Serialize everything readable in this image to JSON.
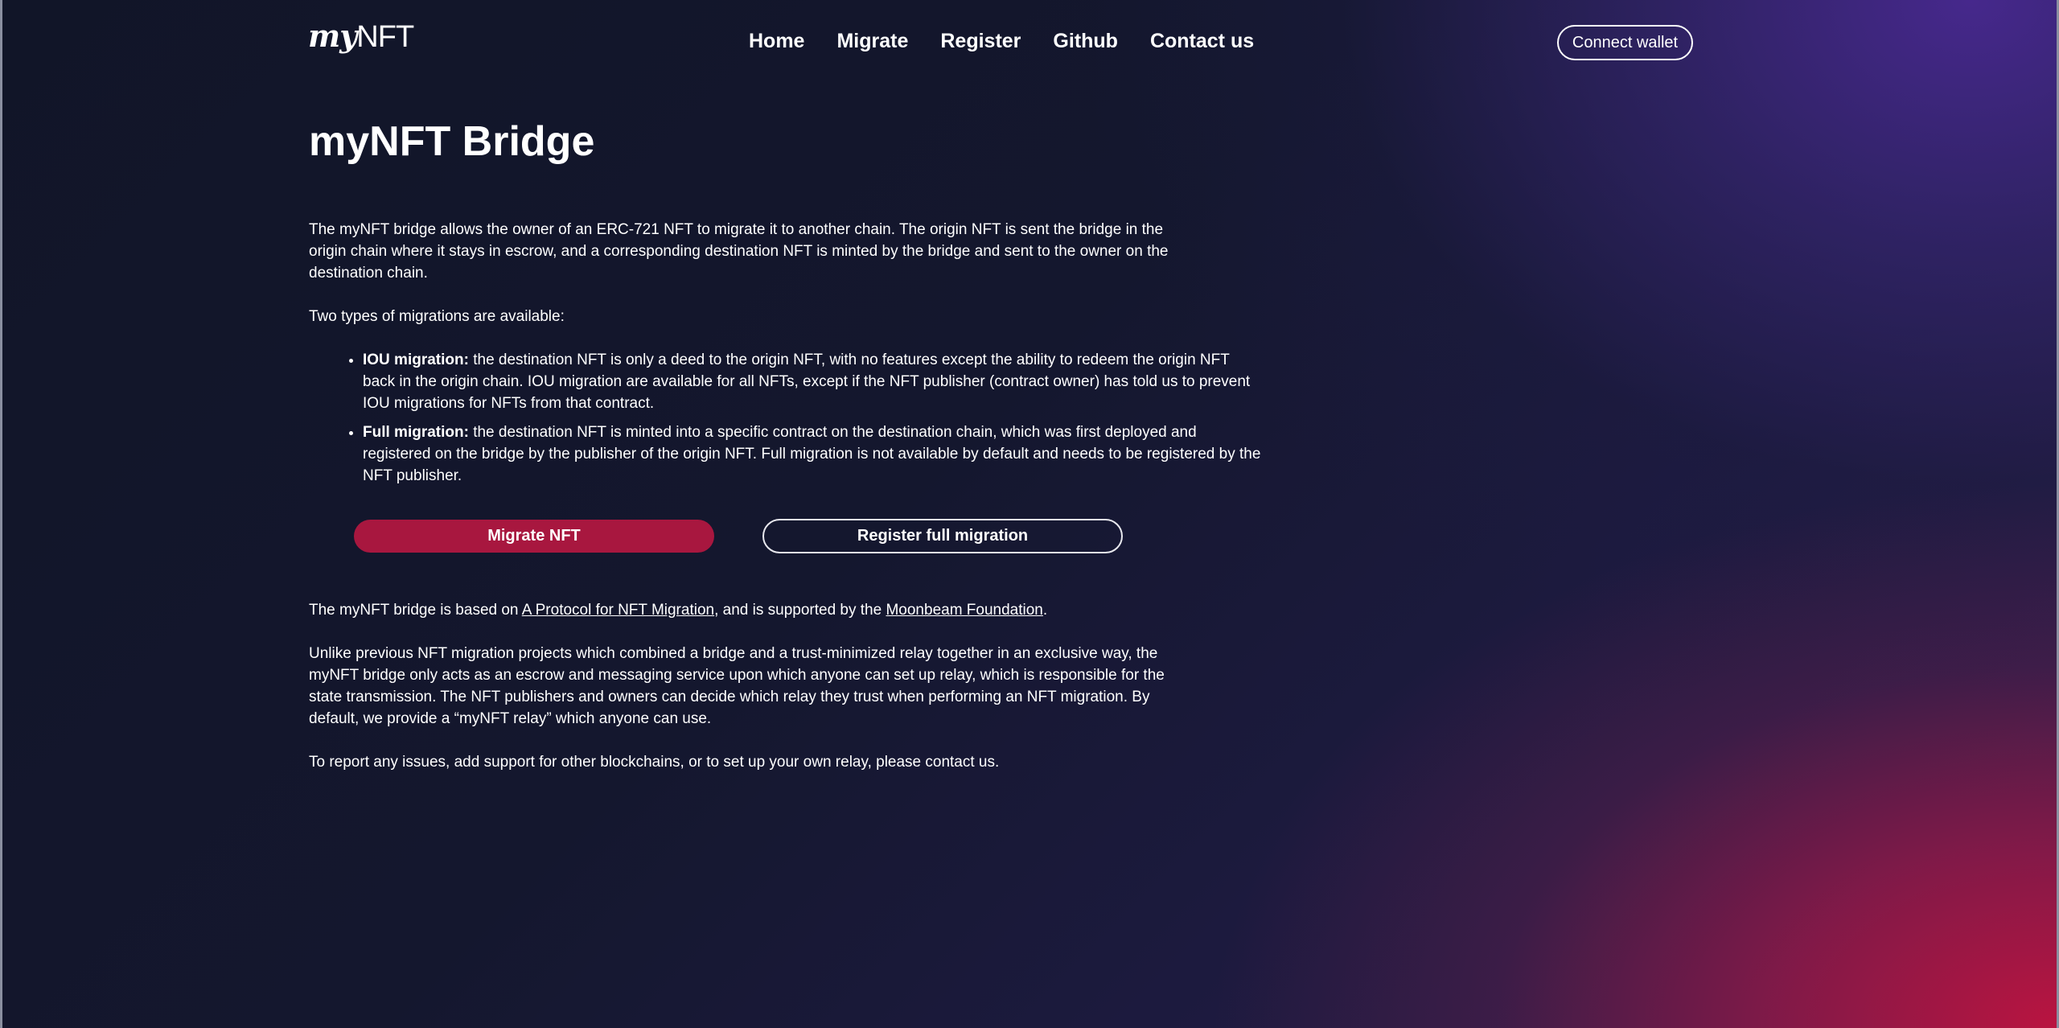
{
  "header": {
    "logo_my": "my",
    "logo_nft": "NFT",
    "nav": [
      "Home",
      "Migrate",
      "Register",
      "Github",
      "Contact us"
    ],
    "connect_wallet": "Connect wallet"
  },
  "main": {
    "title": "myNFT Bridge",
    "intro": "The myNFT bridge allows the owner of an ERC-721 NFT to migrate it to another chain. The origin NFT is sent the bridge in the origin chain where it stays in escrow, and a corresponding destination NFT is minted by the bridge and sent to the owner on the destination chain.",
    "types_intro": "Two types of migrations are available:",
    "types": [
      {
        "name": "IOU migration:",
        "text": " the destination NFT is only a deed to the origin NFT, with no features except the ability to redeem the origin NFT back in the origin chain. IOU migration are available for all NFTs, except if the NFT publisher (contract owner) has told us to prevent IOU migrations for NFTs from that contract."
      },
      {
        "name": "Full migration:",
        "text": " the destination NFT is minted into a specific contract on the destination chain, which was first deployed and registered on the bridge by the publisher of the origin NFT. Full migration is not available by default and needs to be registered by the NFT publisher."
      }
    ],
    "migrate_button": "Migrate NFT",
    "register_button": "Register full migration",
    "based_on_prefix": "The myNFT bridge is based on ",
    "protocol_link": "A Protocol for NFT Migration",
    "based_on_middle": ", and is supported by the ",
    "moonbeam_link": "Moonbeam Foundation",
    "based_on_suffix": ".",
    "relay_text": "Unlike previous NFT migration projects which combined a bridge and a trust-minimized relay together in an exclusive way, the myNFT bridge only acts as an escrow and messaging service upon which anyone can set up relay, which is responsible for the state transmission. The NFT publishers and owners can decide which relay they trust when performing an NFT migration. By default, we provide a “myNFT relay” which anyone can use.",
    "report_text": "To report any issues, add support for other blockchains, or to set up your own relay, please contact us."
  }
}
